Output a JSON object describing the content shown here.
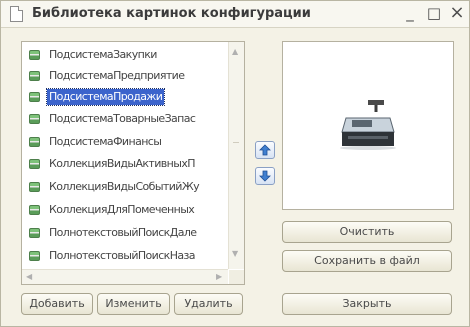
{
  "window": {
    "title": "Библиотека картинок конфигурации",
    "minimize": "_",
    "maximize": "□",
    "close": "×"
  },
  "list": {
    "items": [
      {
        "label": "ПодсистемаЗакупки",
        "selected": false
      },
      {
        "label": "ПодсистемаПредприятие",
        "selected": false
      },
      {
        "label": "ПодсистемаПродажи",
        "selected": true
      },
      {
        "label": "ПодсистемаТоварныеЗапас",
        "selected": false
      },
      {
        "label": "ПодсистемаФинансы",
        "selected": false
      },
      {
        "label": "КоллекцияВидыАктивныхП",
        "selected": false
      },
      {
        "label": "КоллекцияВидыСобытийЖу",
        "selected": false
      },
      {
        "label": "КоллекцияДляПомеченных",
        "selected": false
      },
      {
        "label": "ПолнотекстовыйПоискДале",
        "selected": false
      },
      {
        "label": "ПолнотекстовыйПоискНаза",
        "selected": false
      }
    ]
  },
  "buttons": {
    "add": "Добавить",
    "edit": "Изменить",
    "delete": "Удалить",
    "clear": "Очистить",
    "save_to_file": "Сохранить в файл",
    "close": "Закрыть"
  },
  "icons": {
    "title": "document-icon",
    "item": "subsystem-icon",
    "preview": "cash-register-icon",
    "move_up": "arrow-up-icon",
    "move_down": "arrow-down-icon"
  },
  "colors": {
    "selection": "#3c64cc",
    "window_bg": "#f4f2e6"
  }
}
